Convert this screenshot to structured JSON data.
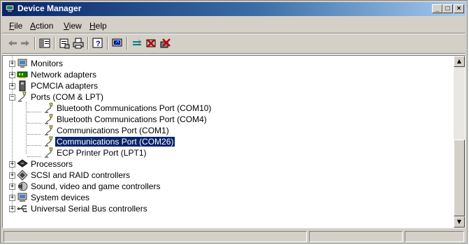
{
  "window": {
    "title": "Device Manager",
    "title_icon": "device-manager-icon"
  },
  "window_controls": {
    "minimize": "_",
    "maximize": "□",
    "close": "×"
  },
  "menu": [
    {
      "key": "F",
      "rest": "ile"
    },
    {
      "key": "A",
      "rest": "ction"
    },
    {
      "key": "V",
      "rest": "iew"
    },
    {
      "key": "H",
      "rest": "elp"
    }
  ],
  "toolbar": {
    "items": [
      "back-arrow-icon",
      "forward-arrow-icon",
      "show-hide-console-tree-icon",
      "properties-icon",
      "print-icon",
      "help-icon",
      "scan-hardware-changes-icon",
      "update-driver-icon",
      "disable-device-icon",
      "uninstall-device-icon"
    ]
  },
  "tree": {
    "categories_before": [
      {
        "label": "Monitors",
        "icon": "monitor-icon"
      },
      {
        "label": "Network adapters",
        "icon": "network-adapter-icon"
      },
      {
        "label": "PCMCIA adapters",
        "icon": "pcmcia-icon"
      }
    ],
    "expanded": {
      "label": "Ports (COM & LPT)",
      "icon": "port-icon",
      "children": [
        {
          "label": "Bluetooth Communications Port (COM10)"
        },
        {
          "label": "Bluetooth Communications Port (COM4)"
        },
        {
          "label": "Communications Port (COM1)"
        },
        {
          "label": "Communications Port (COM26)",
          "selected": true
        },
        {
          "label": "ECP Printer Port (LPT1)"
        }
      ]
    },
    "categories_after": [
      {
        "label": "Processors",
        "icon": "processor-icon"
      },
      {
        "label": "SCSI and RAID controllers",
        "icon": "scsi-icon"
      },
      {
        "label": "Sound, video and game controllers",
        "icon": "sound-icon"
      },
      {
        "label": "System devices",
        "icon": "system-devices-icon"
      },
      {
        "label": "Universal Serial Bus controllers",
        "icon": "usb-icon"
      }
    ]
  },
  "scrollbar": {
    "up": "▲",
    "down": "▼"
  },
  "status": {
    "panels": [
      "",
      "",
      ""
    ]
  }
}
